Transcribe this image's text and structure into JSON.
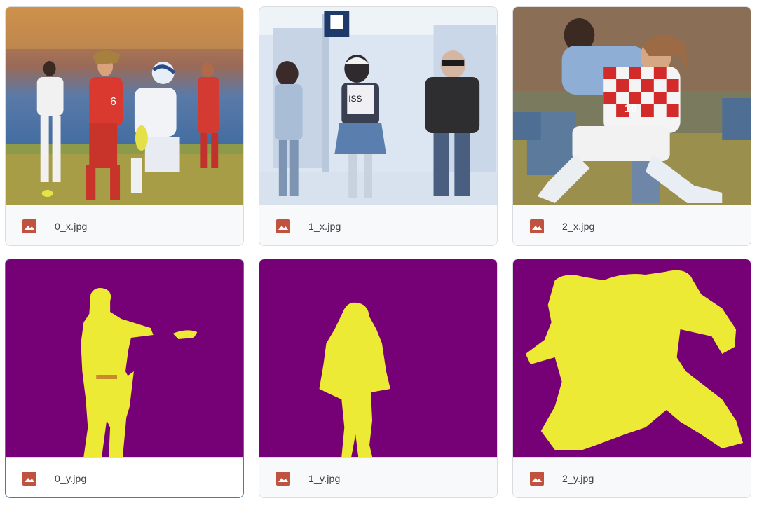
{
  "files": [
    {
      "name": "0_x.jpg",
      "kind": "photo-soccer-players",
      "icon": "image-icon"
    },
    {
      "name": "1_x.jpg",
      "kind": "photo-people-walking",
      "icon": "image-icon"
    },
    {
      "name": "2_x.jpg",
      "kind": "photo-soccer-tackle",
      "icon": "image-icon"
    },
    {
      "name": "0_y.jpg",
      "kind": "mask-soccer-players",
      "icon": "image-icon",
      "selected": true
    },
    {
      "name": "1_y.jpg",
      "kind": "mask-people-walking",
      "icon": "image-icon"
    },
    {
      "name": "2_y.jpg",
      "kind": "mask-soccer-tackle",
      "icon": "image-icon"
    }
  ],
  "colors": {
    "icon_red": "#c0533f",
    "mask_background": "#760076",
    "mask_foreground": "#ecea34",
    "selected_border": "#4a7ba8"
  }
}
